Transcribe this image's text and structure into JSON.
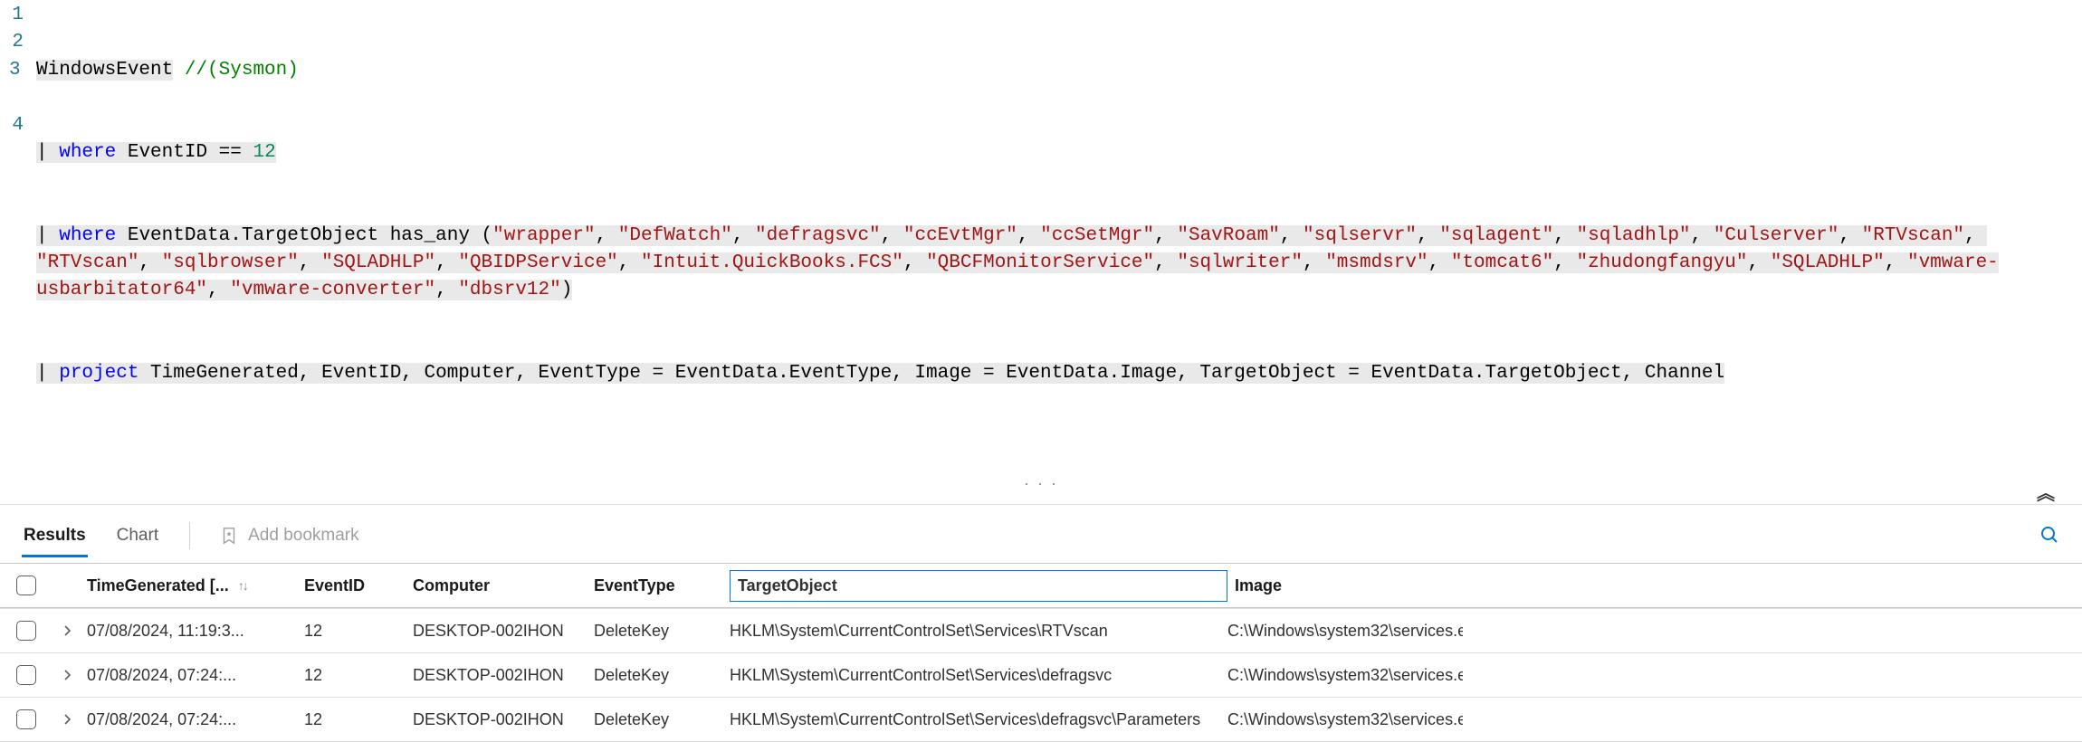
{
  "query": {
    "lines": [
      "1",
      "2",
      "3",
      "4"
    ],
    "l1_table": "WindowsEvent",
    "l1_comment": "//(Sysmon)",
    "l2_pipe": "|",
    "l2_where": "where",
    "l2_col": "EventID",
    "l2_eq": "==",
    "l2_num": "12",
    "l3_pipe": "|",
    "l3_where": "where",
    "l3_target": "EventData.TargetObject",
    "l3_func": "has_any",
    "l3_open": "(",
    "l3_close": ")",
    "l3_strings": [
      "\"wrapper\"",
      "\"DefWatch\"",
      "\"defragsvc\"",
      "\"ccEvtMgr\"",
      "\"ccSetMgr\"",
      "\"SavRoam\"",
      "\"sqlservr\"",
      "\"sqlagent\"",
      "\"sqladhlp\"",
      "\"Culserver\"",
      "\"RTVscan\"",
      "\"RTVscan\"",
      "\"sqlbrowser\"",
      "\"SQLADHLP\"",
      "\"QBIDPService\"",
      "\"Intuit.QuickBooks.FCS\"",
      "\"QBCFMonitorService\"",
      "\"sqlwriter\"",
      "\"msmdsrv\"",
      "\"tomcat6\"",
      "\"zhudongfangyu\"",
      "\"SQLADHLP\"",
      "\"vmware-usbarbitator64\"",
      "\"vmware-converter\"",
      "\"dbsrv12\""
    ],
    "l4_pipe": "|",
    "l4_project": "project",
    "l4_rest": "TimeGenerated, EventID, Computer, EventType = EventData.EventType, Image = EventData.Image, TargetObject = EventData.TargetObject, Channel"
  },
  "toolbar": {
    "tab_results": "Results",
    "tab_chart": "Chart",
    "bookmark_label": "Add bookmark",
    "expand_chevron": "︽",
    "ellipsis": "· · ·"
  },
  "columns": {
    "time": "TimeGenerated [...",
    "eventid": "EventID",
    "computer": "Computer",
    "eventtype": "EventType",
    "target": "TargetObject",
    "image": "Image",
    "sort_glyph": "↑↓"
  },
  "rows": [
    {
      "time": "07/08/2024, 11:19:3...",
      "eventid": "12",
      "computer": "DESKTOP-002IHON",
      "eventtype": "DeleteKey",
      "target": "HKLM\\System\\CurrentControlSet\\Services\\RTVscan",
      "image": "C:\\Windows\\system32\\services.e"
    },
    {
      "time": "07/08/2024, 07:24:...",
      "eventid": "12",
      "computer": "DESKTOP-002IHON",
      "eventtype": "DeleteKey",
      "target": "HKLM\\System\\CurrentControlSet\\Services\\defragsvc",
      "image": "C:\\Windows\\system32\\services.e"
    },
    {
      "time": "07/08/2024, 07:24:...",
      "eventid": "12",
      "computer": "DESKTOP-002IHON",
      "eventtype": "DeleteKey",
      "target": "HKLM\\System\\CurrentControlSet\\Services\\defragsvc\\Parameters",
      "image": "C:\\Windows\\system32\\services.e"
    }
  ]
}
